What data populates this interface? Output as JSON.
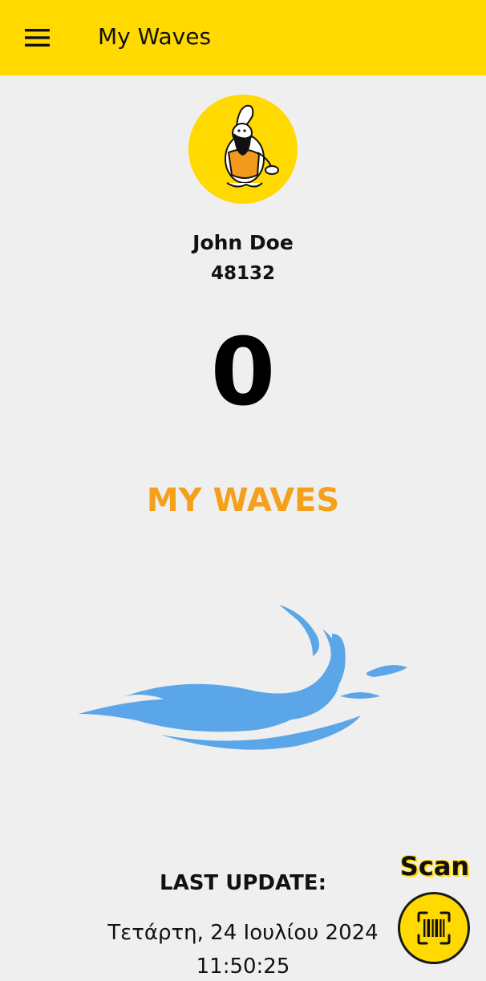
{
  "app_bar": {
    "title": "My Waves",
    "menu_icon": "hamburger-menu-icon",
    "background": "#ffd900"
  },
  "profile": {
    "avatar_icon": "caveman-mascot-icon",
    "name": "John Doe",
    "id": "48132"
  },
  "waves": {
    "count": "0",
    "title": "MY WAVES",
    "title_color": "#f5a01a",
    "graphic_icon": "wave-splash-icon",
    "graphic_color": "#5aa6e8"
  },
  "last_update": {
    "label": "LAST UPDATE:",
    "date": "Τετάρτη, 24 Ιουλίου 2024",
    "time": "11:50:25"
  },
  "scan": {
    "label": "Scan",
    "icon": "barcode-scan-icon"
  }
}
